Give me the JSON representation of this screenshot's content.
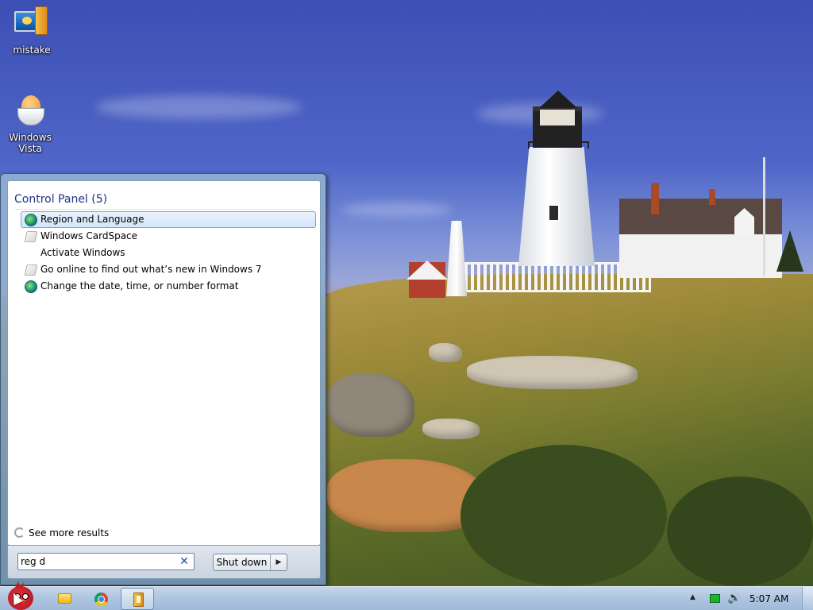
{
  "desktop": {
    "icons": [
      {
        "label": "mistake",
        "icon": "computer-app-icon"
      },
      {
        "label": "Windows\nVista",
        "icon": "egg-cup-icon"
      }
    ]
  },
  "start_menu": {
    "group_title": "Control Panel (5)",
    "results": [
      {
        "label": "Region and Language",
        "icon": "globe-icon",
        "selected": true
      },
      {
        "label": "Windows CardSpace",
        "icon": "document-icon"
      },
      {
        "label": "Activate Windows",
        "icon": ""
      },
      {
        "label": "Go online to find out what’s new in Windows 7",
        "icon": "document-icon"
      },
      {
        "label": "Change the date, time, or number format",
        "icon": "globe-icon"
      }
    ],
    "see_more": "See more results",
    "search_value": "reg d",
    "shutdown_label": "Shut down",
    "shutdown_arrow": "▶"
  },
  "taskbar": {
    "pinned": [
      "folder-icon",
      "chrome-icon",
      "app-icon"
    ],
    "tray": {
      "overflow_arrow": "▲",
      "volume_glyph": "🔊",
      "clock": "5:07 AM"
    }
  }
}
